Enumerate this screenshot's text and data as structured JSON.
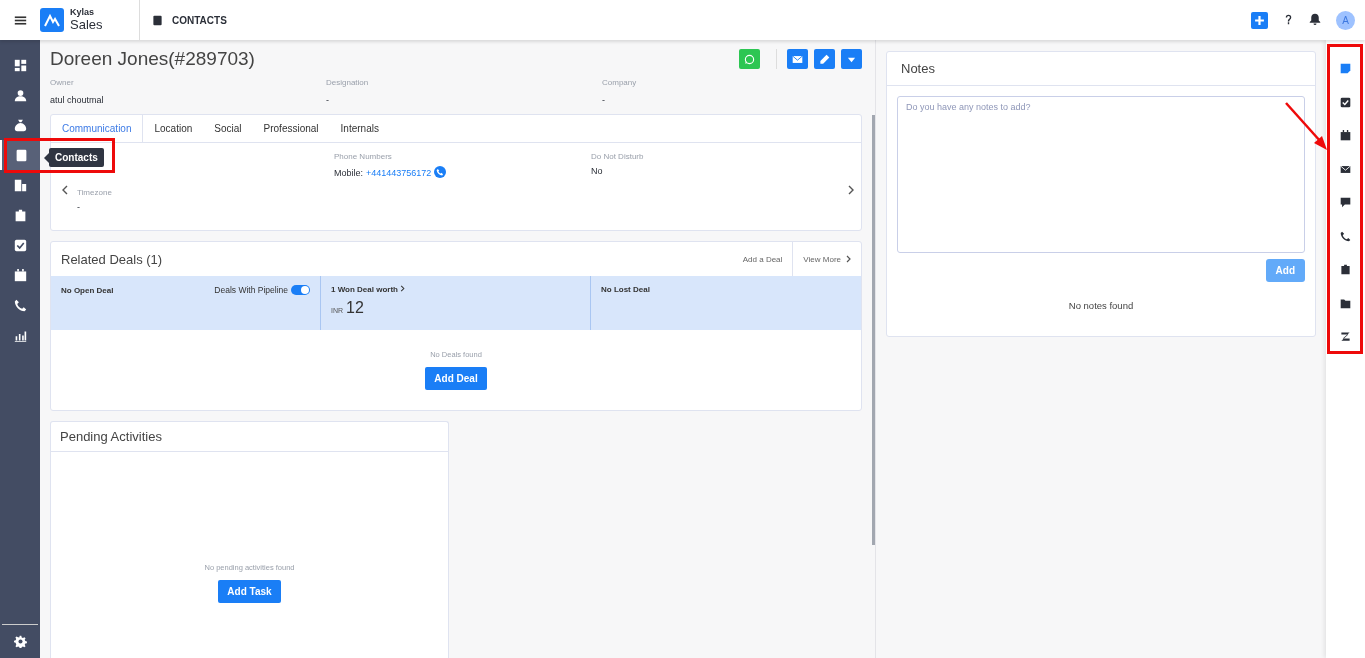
{
  "topbar": {
    "brand_top": "Kylas",
    "brand_bottom": "Sales",
    "module": "CONTACTS",
    "avatar": "A"
  },
  "sidebar": {
    "items": [
      {
        "kind": "dashboard",
        "selected": false
      },
      {
        "kind": "person",
        "selected": false
      },
      {
        "kind": "moneybag",
        "selected": false
      },
      {
        "kind": "contact",
        "selected": true
      },
      {
        "kind": "building",
        "selected": false
      },
      {
        "kind": "clipboard",
        "selected": false
      },
      {
        "kind": "check",
        "selected": false
      },
      {
        "kind": "calendar",
        "selected": false
      },
      {
        "kind": "phone",
        "selected": false
      },
      {
        "kind": "chart",
        "selected": false
      }
    ],
    "tooltip": "Contacts"
  },
  "contact": {
    "name": "Doreen Jones(#289703)",
    "fields": [
      {
        "label": "Owner",
        "value": "atul choutmal"
      },
      {
        "label": "Designation",
        "value": "-"
      },
      {
        "label": "Company",
        "value": "-"
      }
    ]
  },
  "tabs": [
    {
      "label": "Communication",
      "selected": true
    },
    {
      "label": "Location",
      "selected": false
    },
    {
      "label": "Social",
      "selected": false
    },
    {
      "label": "Professional",
      "selected": false
    },
    {
      "label": "Internals",
      "selected": false
    }
  ],
  "communication": {
    "phone_label": "Phone Numbers",
    "phone_prefix": "Mobile:",
    "phone_number": "+441443756172",
    "dnd_label": "Do Not Disturb",
    "dnd_value": "No",
    "timezone_label": "Timezone",
    "timezone_value": "-"
  },
  "related_deals": {
    "title": "Related Deals (1)",
    "add_link": "Add a Deal",
    "view_more": "View More",
    "open": "No Open Deal",
    "pipeline_toggle": {
      "label": "Deals With Pipeline",
      "on": true
    },
    "won": "1 Won Deal worth",
    "currency": "INR",
    "amount": "12",
    "lost": "No Lost Deal",
    "empty": "No Deals found",
    "button": "Add Deal"
  },
  "pending_activities": {
    "title": "Pending Activities",
    "empty": "No pending activities found",
    "button": "Add Task"
  },
  "notes": {
    "title": "Notes",
    "placeholder": "Do you have any notes to add?",
    "button": {
      "label": "Add",
      "disabled": true
    },
    "empty": "No notes found"
  },
  "right_rail": {
    "items": [
      {
        "kind": "note",
        "selected": true
      },
      {
        "kind": "task",
        "selected": false
      },
      {
        "kind": "calendar",
        "selected": false
      },
      {
        "kind": "mail",
        "selected": false
      },
      {
        "kind": "chat",
        "selected": false
      },
      {
        "kind": "phone",
        "selected": false
      },
      {
        "kind": "clipboard",
        "selected": false
      },
      {
        "kind": "folder",
        "selected": false
      },
      {
        "kind": "zendesk",
        "selected": false
      }
    ]
  }
}
